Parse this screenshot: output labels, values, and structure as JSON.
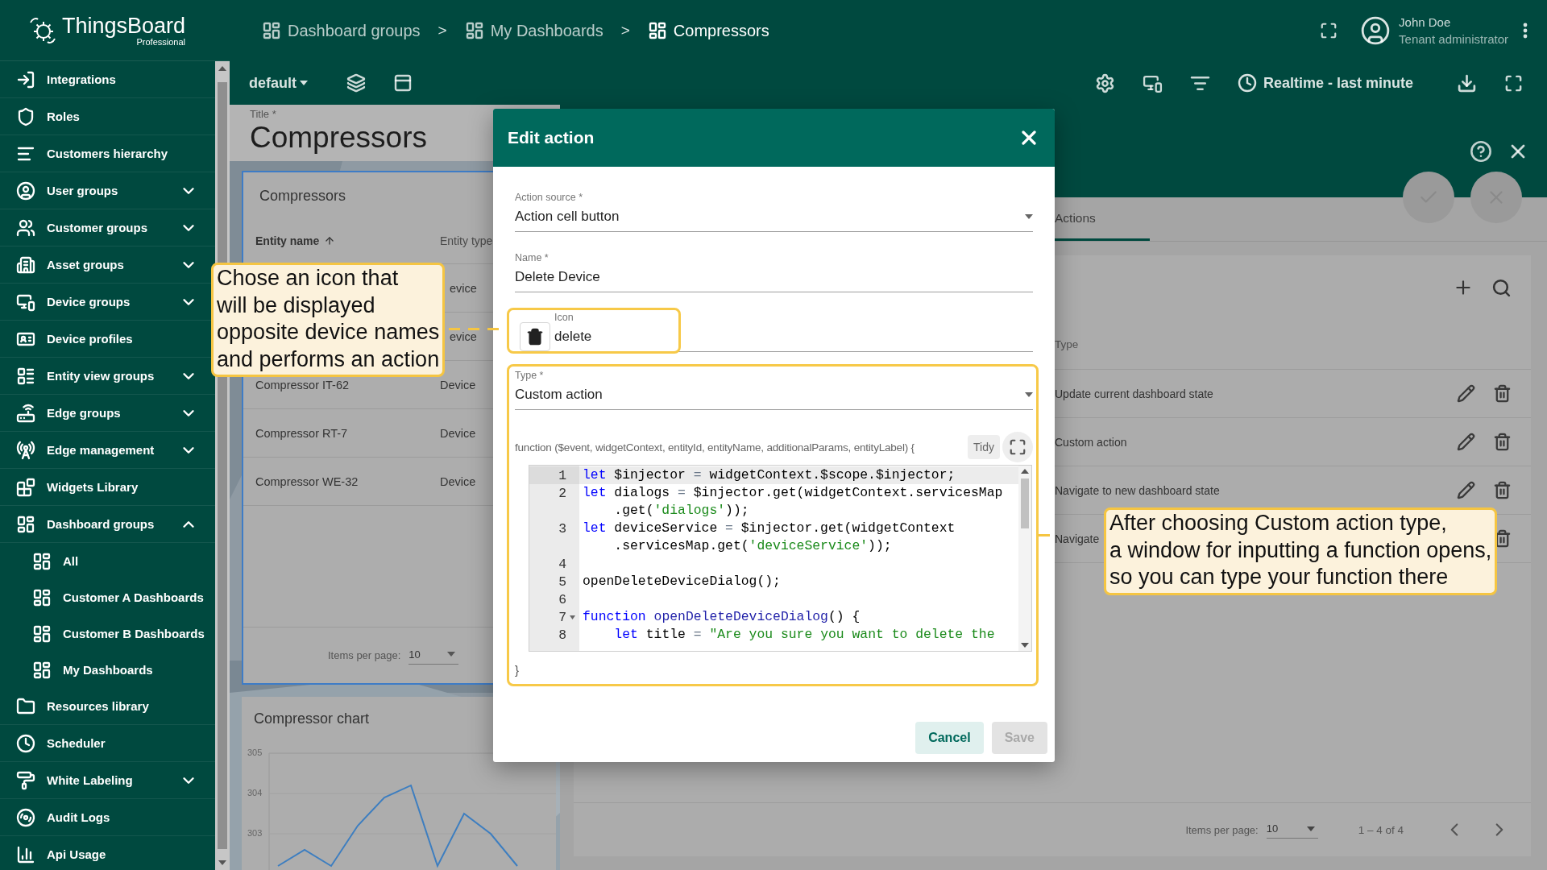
{
  "sidebar": {
    "logo": {
      "name": "ThingsBoard",
      "edition": "Professional"
    },
    "items": [
      {
        "label": "Integrations"
      },
      {
        "label": "Roles"
      },
      {
        "label": "Customers hierarchy"
      },
      {
        "label": "User groups",
        "expanded": false
      },
      {
        "label": "Customer groups",
        "expanded": false
      },
      {
        "label": "Asset groups",
        "expanded": false
      },
      {
        "label": "Device groups",
        "expanded": false
      },
      {
        "label": "Device profiles"
      },
      {
        "label": "Entity view groups",
        "expanded": false
      },
      {
        "label": "Edge groups",
        "expanded": false
      },
      {
        "label": "Edge management",
        "expanded": false
      },
      {
        "label": "Widgets Library"
      },
      {
        "label": "Dashboard groups",
        "expanded": true,
        "children": [
          {
            "label": "All"
          },
          {
            "label": "Customer A Dashboards"
          },
          {
            "label": "Customer B Dashboards"
          },
          {
            "label": "My Dashboards"
          }
        ]
      },
      {
        "label": "Resources library"
      },
      {
        "label": "Scheduler"
      },
      {
        "label": "White Labeling",
        "expanded": false
      },
      {
        "label": "Audit Logs"
      },
      {
        "label": "Api Usage"
      }
    ]
  },
  "header": {
    "separator": ">",
    "breadcrumbs": [
      {
        "label": "Dashboard groups",
        "current": false
      },
      {
        "label": "My Dashboards",
        "current": false
      },
      {
        "label": "Compressors",
        "current": true
      }
    ],
    "user": {
      "name": "John Doe",
      "role": "Tenant administrator"
    }
  },
  "toolbar": {
    "layout": "default",
    "timewindow": "Realtime - last minute"
  },
  "dashboard": {
    "title_label": "Title *",
    "title": "Compressors",
    "entity_table": {
      "title": "Compressors",
      "columns": [
        {
          "label": "Entity name",
          "sorted": true
        },
        {
          "label": "Entity type",
          "sorted": false
        }
      ],
      "rows": [
        {
          "type": "evice"
        },
        {
          "type": "evice"
        },
        {
          "name": "Compressor IT-62",
          "type": "Device"
        },
        {
          "name": "Compressor RT-7",
          "type": "Device"
        },
        {
          "name": "Compressor WE-32",
          "type": "Device"
        }
      ],
      "pagination": {
        "label": "Items per page:",
        "value": "10"
      }
    },
    "chart_widget": {
      "title": "Compressor chart",
      "chart_data": {
        "type": "line",
        "ylim": [
          302,
          305
        ],
        "yticks": [
          303,
          304,
          305
        ],
        "series": [
          {
            "color": "#3d7ec0",
            "values": [
              302.2,
              302.6,
              302.2,
              303.2,
              303.9,
              304.2,
              302.2,
              303.5,
              303.0,
              302.2
            ]
          }
        ]
      }
    }
  },
  "edit_panel": {
    "tabs": [
      {
        "label": "Actions",
        "selected": true
      }
    ],
    "actions_table": {
      "columns": [
        {
          "label": "Type"
        }
      ],
      "rows": [
        {
          "type": "Update current dashboard state",
          "covered": false
        },
        {
          "type": "Custom action",
          "covered": false
        },
        {
          "type": "Navigate to new dashboard state",
          "covered": false
        },
        {
          "type": "Navigate",
          "covered": true
        }
      ],
      "pagination": {
        "label": "Items per page:",
        "value": "10",
        "range": "1 – 4 of 4"
      }
    }
  },
  "dialog": {
    "title": "Edit action",
    "fields": [
      {
        "kind": "select",
        "label": "Action source *",
        "value": "Action cell button"
      },
      {
        "kind": "text",
        "label": "Name *",
        "value": "Delete Device"
      },
      {
        "kind": "icon",
        "label": "Icon",
        "value": "delete",
        "highlighted": true
      },
      {
        "kind": "select",
        "label": "Type *",
        "value": "Custom action",
        "highlighted": true,
        "function": {
          "signature": "function ($event, widgetContext, entityId, entityName, additionalParams, entityLabel) {",
          "tidy": "Tidy",
          "closing": "}",
          "lines": [
            {
              "number": "1",
              "active": true,
              "rows": [
                "let $injector = widgetContext.$scope.$injector;"
              ]
            },
            {
              "number": "2",
              "active": false,
              "rows": [
                "let dialogs = $injector.get(widgetContext.servicesMap",
                "    .get('dialogs'));"
              ]
            },
            {
              "number": "3",
              "active": false,
              "rows": [
                "let deviceService = $injector.get(widgetContext",
                "    .servicesMap.get('deviceService'));"
              ]
            },
            {
              "number": "4",
              "active": false
            },
            {
              "number": "5",
              "active": false,
              "rows": [
                "openDeleteDeviceDialog();"
              ]
            },
            {
              "number": "6",
              "active": false
            },
            {
              "number": "7",
              "active": false,
              "foldable": true,
              "rows": [
                "function openDeleteDeviceDialog() {"
              ]
            },
            {
              "number": "8",
              "active": false,
              "rows": [
                "    let title = \"Are you sure you want to delete the"
              ]
            }
          ]
        }
      }
    ],
    "buttons": [
      {
        "label": "Cancel",
        "disabled": false
      },
      {
        "label": "Save",
        "disabled": true
      }
    ]
  },
  "callouts": [
    {
      "text": "Chose an icon that\nwill be displayed\nopposite device names\nand performs an action"
    },
    {
      "text": "After choosing Custom action type,\na window for inputting a function opens,\nso you can type your function there"
    }
  ]
}
